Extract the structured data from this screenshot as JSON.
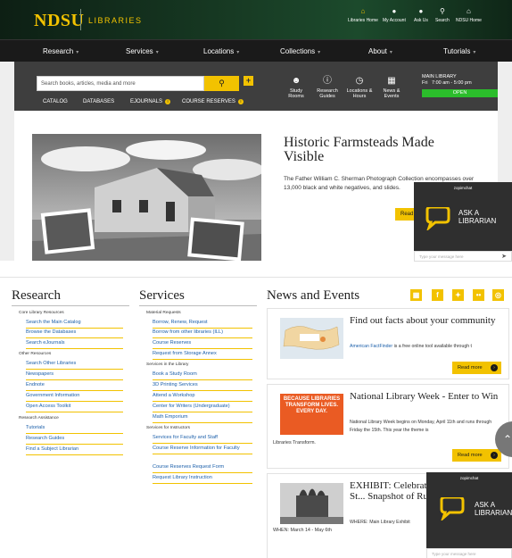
{
  "header": {
    "logo_main": "NDSU",
    "logo_sub": "LIBRARIES",
    "utility": [
      {
        "label": "Libraries Home",
        "icon": "home-icon"
      },
      {
        "label": "My Account",
        "icon": "user-icon"
      },
      {
        "label": "Ask Us",
        "icon": "chat-icon"
      },
      {
        "label": "Search",
        "icon": "search-icon"
      },
      {
        "label": "NDSU Home",
        "icon": "building-icon"
      }
    ]
  },
  "nav": [
    "Research",
    "Services",
    "Locations",
    "Collections",
    "About",
    "Tutorials"
  ],
  "search": {
    "placeholder": "Search books, articles, media and more",
    "tabs": [
      "CATALOG",
      "DATABASES",
      "EJOURNALS",
      "COURSE RESERVES"
    ]
  },
  "quicklinks": [
    {
      "label": "Study Rooms",
      "icon": "people-icon"
    },
    {
      "label": "Research Guides",
      "icon": "info-icon"
    },
    {
      "label": "Locations & Hours",
      "icon": "clock-icon"
    },
    {
      "label": "News & Events",
      "icon": "calendar-icon"
    }
  ],
  "hours": {
    "location": "MAIN LIBRARY",
    "day": "Fri",
    "time": "7:00 am - 5:00 pm",
    "status": "OPEN"
  },
  "hero": {
    "title": "Historic Farmsteads Made Visible",
    "text": "The Father William C. Sherman Photograph Collection encompasses over 13,000 black and white negatives, and slides.",
    "button": "Read"
  },
  "chat": {
    "brand": "zopimchat",
    "ask": "ASK A LIBRARIAN",
    "placeholder": "Type your message here"
  },
  "research": {
    "title": "Research",
    "groups": [
      {
        "name": "Core Library Resources",
        "links": [
          "Search the Main Catalog",
          "Browse the Databases",
          "Search eJournals"
        ]
      },
      {
        "name": "Other Resources",
        "links": [
          "Search Other Libraries",
          "Newspapers",
          "Endnote",
          "Government Information",
          "Open Access Toolkit"
        ]
      },
      {
        "name": "Research Assistance",
        "links": [
          "Tutorials",
          "Research Guides",
          "Find a Subject Librarian"
        ]
      }
    ]
  },
  "services": {
    "title": "Services",
    "groups": [
      {
        "name": "Material Requests",
        "links": [
          "Borrow, Renew, Request",
          "Borrow from other libraries (ILL)",
          "Course Reserves",
          "Request from Storage Annex"
        ]
      },
      {
        "name": "Services in the Library",
        "links": [
          "Book a Study Room",
          "3D Printing Services",
          "Attend a Workshop",
          "Center for Writers (Undergraduate)",
          "Math Emporium"
        ]
      },
      {
        "name": "Services for Instructors",
        "links": [
          "Services for Faculty and Staff",
          "Course Reserve Information for Faculty",
          "Course Reserves Request Form",
          "Request Library Instruction"
        ]
      }
    ]
  },
  "news": {
    "title": "News and Events",
    "social": [
      {
        "icon": "calendar-icon",
        "glyph": "▦"
      },
      {
        "icon": "facebook-icon",
        "glyph": "f"
      },
      {
        "icon": "twitter-icon",
        "glyph": "✦"
      },
      {
        "icon": "flickr-icon",
        "glyph": "••"
      },
      {
        "icon": "instagram-icon",
        "glyph": "◎"
      }
    ],
    "items": [
      {
        "title": "Find out facts about your community",
        "link": "American FactFinder",
        "text": " is a free online tool available through t",
        "more": "Read more"
      },
      {
        "title": "National Library Week - Enter to Win",
        "text": "National Library Week begins on Monday, April 11th and runs through Friday the 15th. This year the theme is",
        "thumb_text": "BECAUSE LIBRARIES TRANSFORM LIVES. EVERY DAY.",
        "caption": "Libraries Transform.",
        "more": "Read more"
      },
      {
        "title": "EXHIBIT: Celebrating International St... Snapshot of Rus...",
        "text": "WHERE: Main Library Exhibit",
        "caption": "WHEN: March 14 - May 6th"
      }
    ]
  }
}
